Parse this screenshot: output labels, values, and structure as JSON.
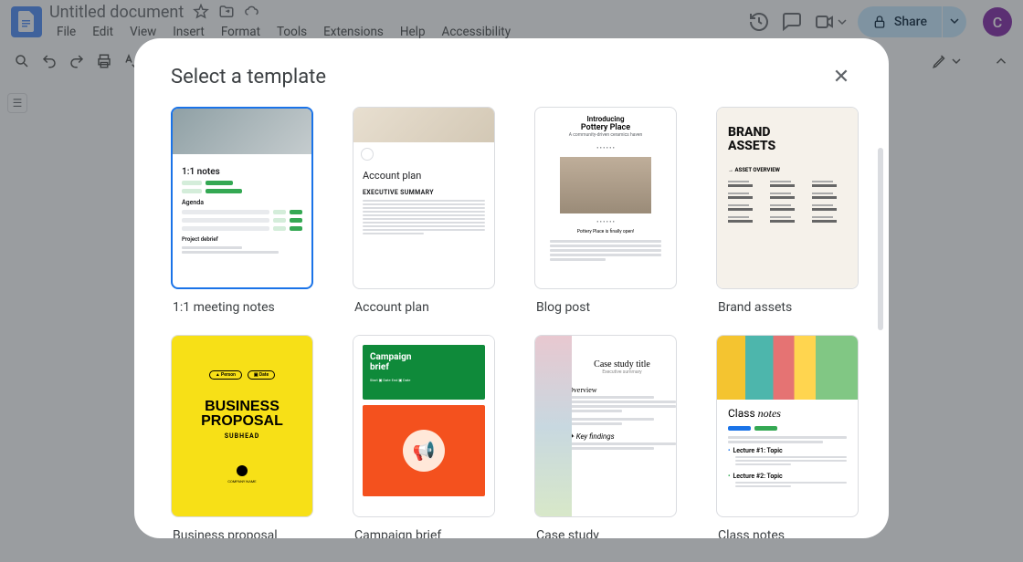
{
  "doc": {
    "title": "Untitled document"
  },
  "menu": {
    "items": [
      "File",
      "Edit",
      "View",
      "Insert",
      "Format",
      "Tools",
      "Extensions",
      "Help",
      "Accessibility"
    ]
  },
  "share": {
    "label": "Share"
  },
  "avatar": {
    "initial": "C"
  },
  "modal": {
    "title": "Select a template",
    "templates": [
      {
        "label": "1:1 meeting notes",
        "selected": true
      },
      {
        "label": "Account plan",
        "selected": false
      },
      {
        "label": "Blog post",
        "selected": false
      },
      {
        "label": "Brand assets",
        "selected": false
      },
      {
        "label": "Business proposal",
        "selected": false
      },
      {
        "label": "Campaign brief",
        "selected": false
      },
      {
        "label": "Case study",
        "selected": false
      },
      {
        "label": "Class notes",
        "selected": false
      }
    ]
  },
  "thumbs": {
    "meeting": {
      "h1": "1:1 notes",
      "h2": "Agenda",
      "h3": "Project debrief"
    },
    "account": {
      "h1": "Account plan",
      "h2": "EXECUTIVE SUMMARY"
    },
    "blog": {
      "h1": "Introducing",
      "h2": "Pottery Place",
      "caption": "Pottery Place is finally open!"
    },
    "brand": {
      "h1": "BRAND",
      "h2": "ASSETS",
      "sub": "→ ASSET OVERVIEW"
    },
    "biz": {
      "p1": "▲ Person",
      "p2": "▣ Date",
      "h1": "BUSINESS",
      "h2": "PROPOSAL",
      "sub": "SUBHEAD",
      "co": "COMPANY NAME"
    },
    "camp": {
      "h1": "Campaign",
      "h2": "brief",
      "dates": "Start ▣ Date   End ▣ Date"
    },
    "case": {
      "h1": "Case study title",
      "sub": "Executive summary",
      "s1": "Overview",
      "s2": "Key findings"
    },
    "class": {
      "h1": "Class ",
      "h1b": "notes",
      "s1": "Lecture #1: Topic",
      "s2": "Lecture #2: Topic"
    }
  }
}
